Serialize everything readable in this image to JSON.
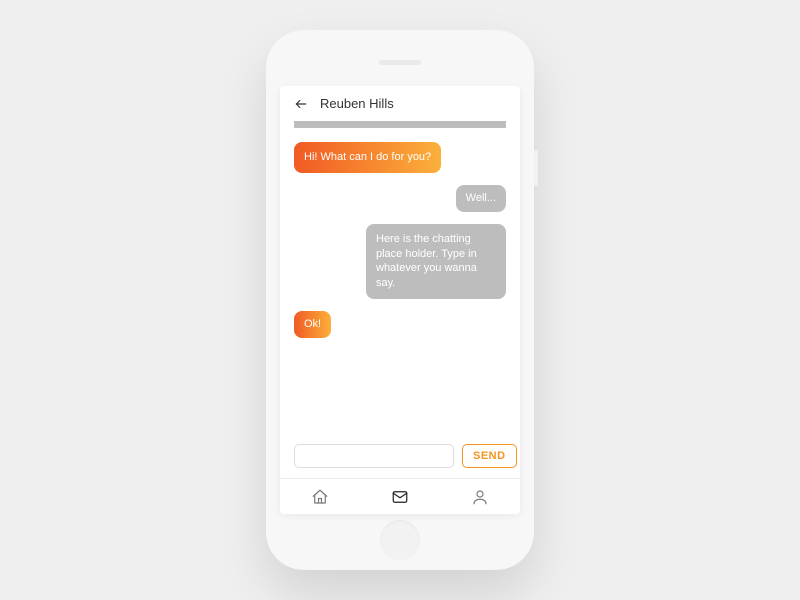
{
  "header": {
    "title": "Reuben Hills"
  },
  "messages": [
    {
      "side": "left",
      "text": "Hi! What can I do for you?"
    },
    {
      "side": "right",
      "text": "Well..."
    },
    {
      "side": "right",
      "text": "Here is the chatting place holder. Type in whatever you wanna say."
    },
    {
      "side": "left",
      "text": "Ok!"
    }
  ],
  "composer": {
    "placeholder": "",
    "send_label": "SEND"
  },
  "colors": {
    "accent_start": "#f15a24",
    "accent_end": "#fbb03b",
    "accent_border": "#f7931e",
    "bubble_grey": "#bdbdbd"
  },
  "tabs": {
    "home": "home",
    "mail": "mail",
    "profile": "profile"
  }
}
